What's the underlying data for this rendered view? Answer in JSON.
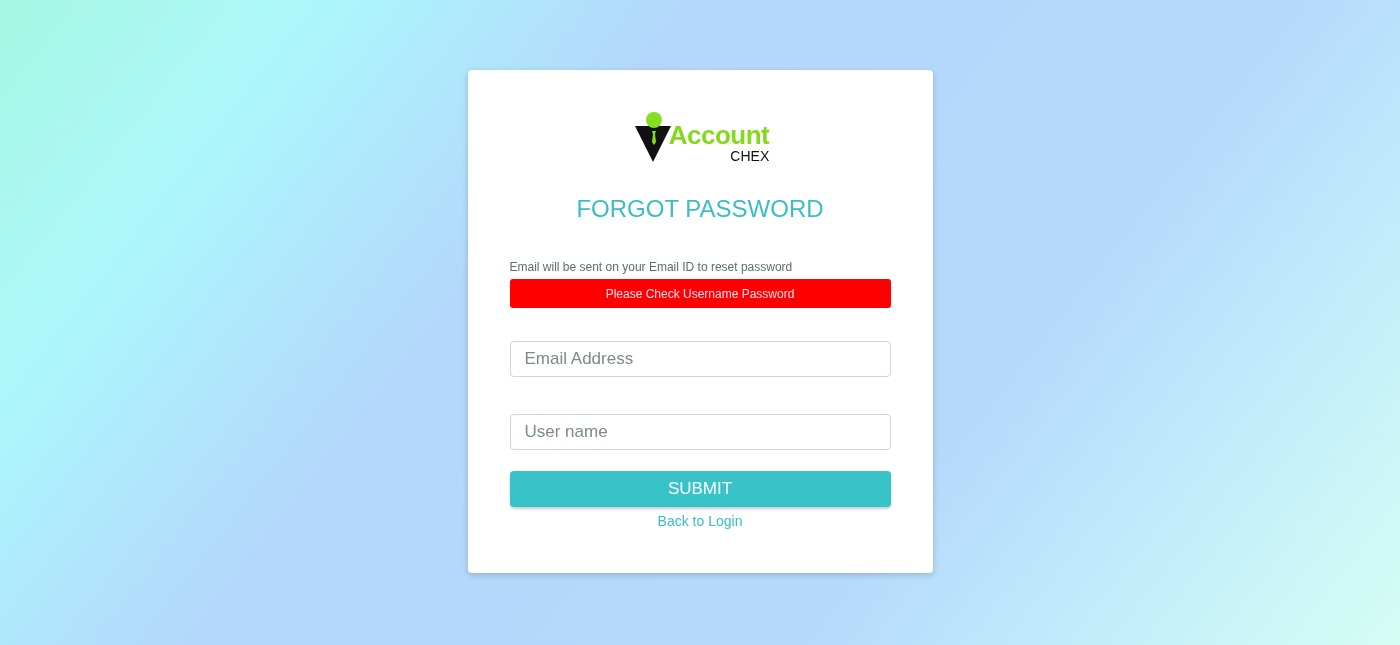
{
  "logo": {
    "word": "Account",
    "subword": "CHEX"
  },
  "title": "FORGOT PASSWORD",
  "hint": "Email will be sent on your Email ID to reset password",
  "alert": {
    "kind": "error",
    "text": "Please Check Username Password"
  },
  "fields": [
    {
      "placeholder": "Email Address"
    },
    {
      "placeholder": "User name"
    }
  ],
  "submit_button": "SUBMIT",
  "back_link": "Back to Login"
}
